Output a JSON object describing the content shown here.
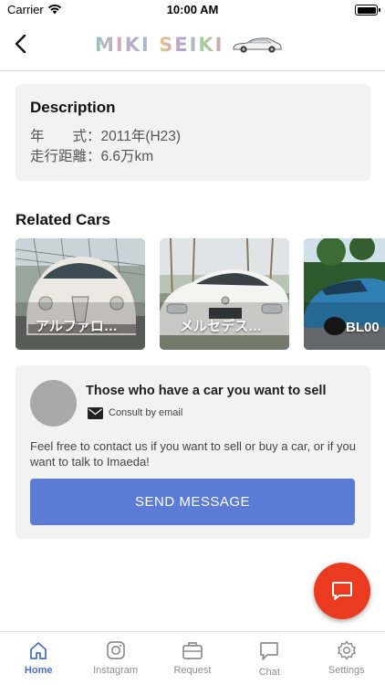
{
  "status_bar": {
    "carrier": "Carrier",
    "time": "10:00 AM"
  },
  "header": {
    "logo_text": "MIKI SEIKI",
    "back_icon": "chevron-left-icon"
  },
  "description": {
    "title": "Description",
    "lines": [
      "年　　式：2011年(H23)",
      "走行距離：6.6万km"
    ]
  },
  "related": {
    "title": "Related Cars",
    "cars": [
      {
        "label": "アルファロ…",
        "color": "#ece9e2"
      },
      {
        "label": "メルセデス…",
        "color": "#f4f4f2"
      },
      {
        "label": "BL00",
        "color": "#2f7fb5"
      }
    ]
  },
  "contact": {
    "title": "Those who have a car you want to sell",
    "consult_label": "Consult by email",
    "body": "Feel free to contact us if you want to sell or buy a car, or if you want to talk to Imaeda!",
    "button_label": "SEND MESSAGE",
    "button_color": "#5b7bd5"
  },
  "fab": {
    "icon": "chat-bubble-icon",
    "color": "#ea3a1f"
  },
  "tabs": [
    {
      "label": "Home",
      "icon": "home-icon",
      "active": true
    },
    {
      "label": "Instagram",
      "icon": "instagram-icon",
      "active": false
    },
    {
      "label": "Request",
      "icon": "briefcase-icon",
      "active": false
    },
    {
      "label": "Chat",
      "icon": "chat-icon",
      "active": false
    },
    {
      "label": "Settings",
      "icon": "gear-icon",
      "active": false
    }
  ],
  "accent_color": "#4a6fcf"
}
